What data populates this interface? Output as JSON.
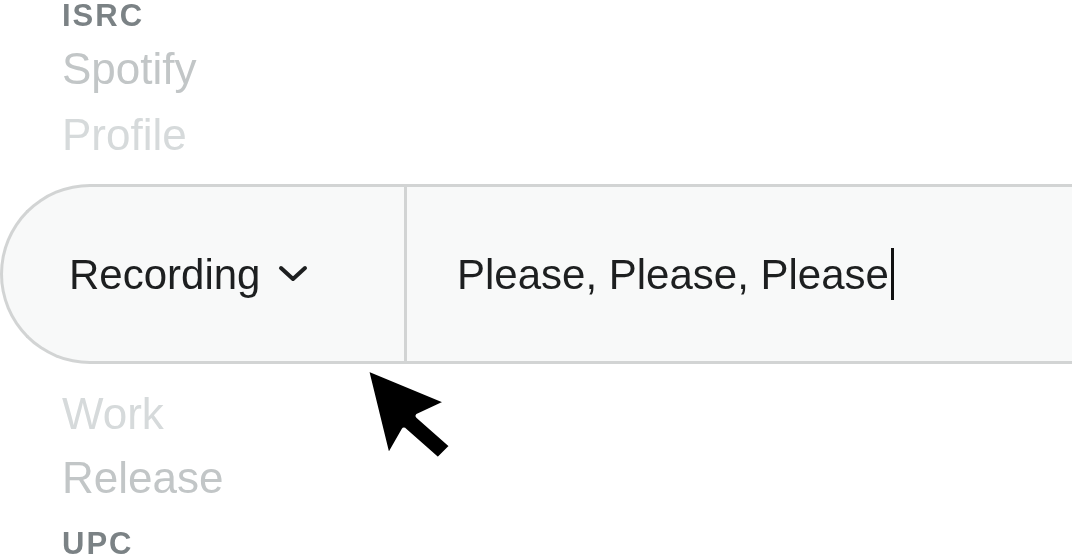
{
  "options_above": [
    {
      "label": "ISRC",
      "kind": "code"
    },
    {
      "label": "Spotify",
      "kind": "medium"
    },
    {
      "label": "Profile",
      "kind": "faint"
    }
  ],
  "search_bar": {
    "type_dropdown": {
      "label": "Recording"
    },
    "query": {
      "value": "Please, Please, Please",
      "focused": true
    }
  },
  "options_below": [
    {
      "label": "Work",
      "kind": "faint"
    },
    {
      "label": "Release",
      "kind": "medium"
    },
    {
      "label": "UPC",
      "kind": "code"
    }
  ]
}
